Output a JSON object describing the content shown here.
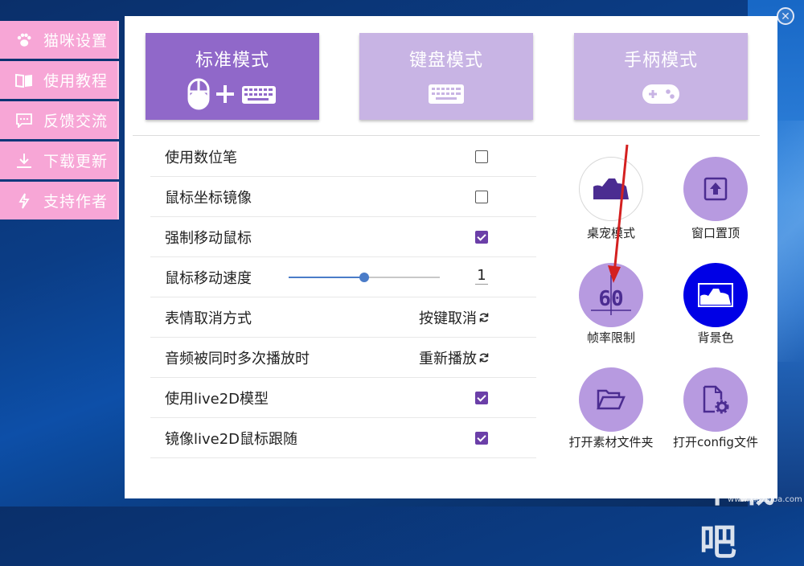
{
  "side_menu": [
    {
      "label": "猫咪设置",
      "icon": "paw-icon"
    },
    {
      "label": "使用教程",
      "icon": "book-icon"
    },
    {
      "label": "反馈交流",
      "icon": "chat-icon"
    },
    {
      "label": "下载更新",
      "icon": "download-icon"
    },
    {
      "label": "支持作者",
      "icon": "lightning-icon"
    }
  ],
  "modes": [
    {
      "label": "标准模式",
      "icons": "mouse-plus-keyboard-icon",
      "active": true
    },
    {
      "label": "键盘模式",
      "icons": "keyboard-icon",
      "active": false
    },
    {
      "label": "手柄模式",
      "icons": "gamepad-icon",
      "active": false
    }
  ],
  "settings": [
    {
      "label": "使用数位笔",
      "type": "checkbox",
      "checked": false
    },
    {
      "label": "鼠标坐标镜像",
      "type": "checkbox",
      "checked": false
    },
    {
      "label": "强制移动鼠标",
      "type": "checkbox",
      "checked": true
    },
    {
      "label": "鼠标移动速度",
      "type": "slider",
      "value": "1",
      "level": 0.5
    },
    {
      "label": "表情取消方式",
      "type": "action",
      "value": "按键取消"
    },
    {
      "label": "音频被同时多次播放时",
      "type": "action",
      "value": "重新播放"
    },
    {
      "label": "使用live2D模型",
      "type": "checkbox",
      "checked": true
    },
    {
      "label": "镜像live2D鼠标跟随",
      "type": "checkbox",
      "checked": true
    }
  ],
  "round_buttons": [
    {
      "label": "桌宠模式",
      "icon": "cat-silhouette-icon"
    },
    {
      "label": "窗口置顶",
      "icon": "pin-top-icon"
    },
    {
      "label": "帧率限制",
      "icon": "fps-60-icon",
      "icon_text": "60"
    },
    {
      "label": "背景色",
      "icon": "background-color-icon"
    },
    {
      "label": "打开素材文件夹",
      "icon": "folder-open-icon"
    },
    {
      "label": "打开config文件",
      "icon": "config-file-icon"
    }
  ],
  "colors": {
    "accent": "#9068c9",
    "accent_light": "#c8b4e4",
    "side_menu_bg": "#f7a6d6",
    "checkbox_on": "#6b3fa8",
    "round_button": "#b79ae0",
    "bg_button_blue": "#0000e6",
    "arrow": "#d42020"
  },
  "watermark": {
    "text": "下载吧",
    "sub": "www.xiazaiba.com"
  }
}
